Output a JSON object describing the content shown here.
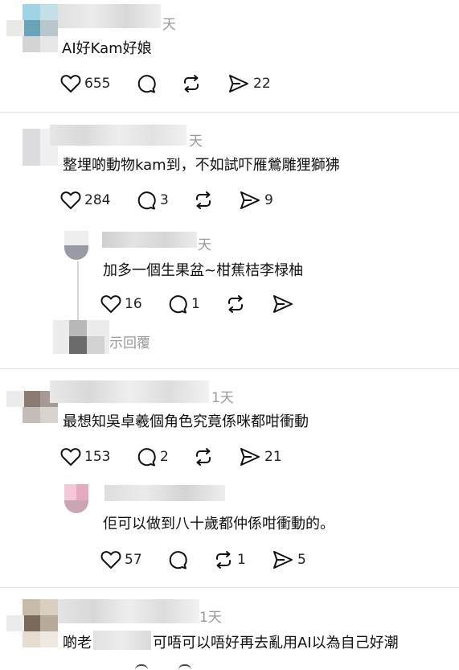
{
  "comments": [
    {
      "time": "天",
      "text": "AI好Kam好娘",
      "likes": "655",
      "replies": "",
      "reposts": "",
      "shares": "22"
    },
    {
      "time": "天",
      "text": "整埋啲動物kam到，不如試吓雁鶯雕狸獅狒",
      "likes": "284",
      "replies": "3",
      "reposts": "",
      "shares": "9"
    },
    {
      "time": "天",
      "text": "加多一個生果盆~柑蕉桔李椂柚",
      "likes": "16",
      "replies": "1",
      "reposts": "",
      "shares": ""
    },
    {
      "time": "1天",
      "text": "最想知吳卓羲個角色究竟係咪都咁衝動",
      "likes": "153",
      "replies": "2",
      "reposts": "",
      "shares": "21"
    },
    {
      "time": "",
      "text": "佢可以做到八十歲都仲係咁衝動的。",
      "likes": "57",
      "replies": "",
      "reposts": "1",
      "shares": "5"
    },
    {
      "time": "1天",
      "text_prefix": "啲老",
      "text_suffix": "可唔可以唔好再去亂用AI以為自己好潮"
    }
  ],
  "show_replies": "顯示回覆",
  "show_replies_visible": "示回覆",
  "icons": [
    "heart-icon",
    "comment-icon",
    "repost-icon",
    "share-icon"
  ]
}
